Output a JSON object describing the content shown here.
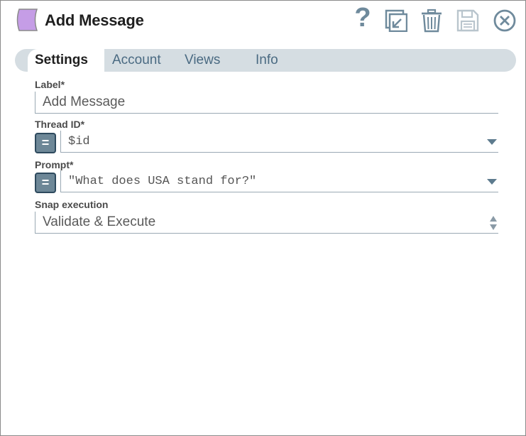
{
  "header": {
    "title": "Add Message",
    "help_glyph": "?",
    "snap_icon_color": "#c59de6",
    "icon_color": "#6f8a9c"
  },
  "tabs": [
    {
      "label": "Settings",
      "active": true
    },
    {
      "label": "Account",
      "active": false
    },
    {
      "label": "Views",
      "active": false
    },
    {
      "label": "Info",
      "active": false
    }
  ],
  "form": {
    "label": {
      "label": "Label*",
      "value": "Add Message"
    },
    "thread_id": {
      "label": "Thread ID*",
      "value": "$id",
      "toggle": "="
    },
    "prompt": {
      "label": "Prompt*",
      "value": "\"What does USA stand for?\"",
      "toggle": "="
    },
    "snap_execution": {
      "label": "Snap execution",
      "value": "Validate & Execute"
    }
  }
}
